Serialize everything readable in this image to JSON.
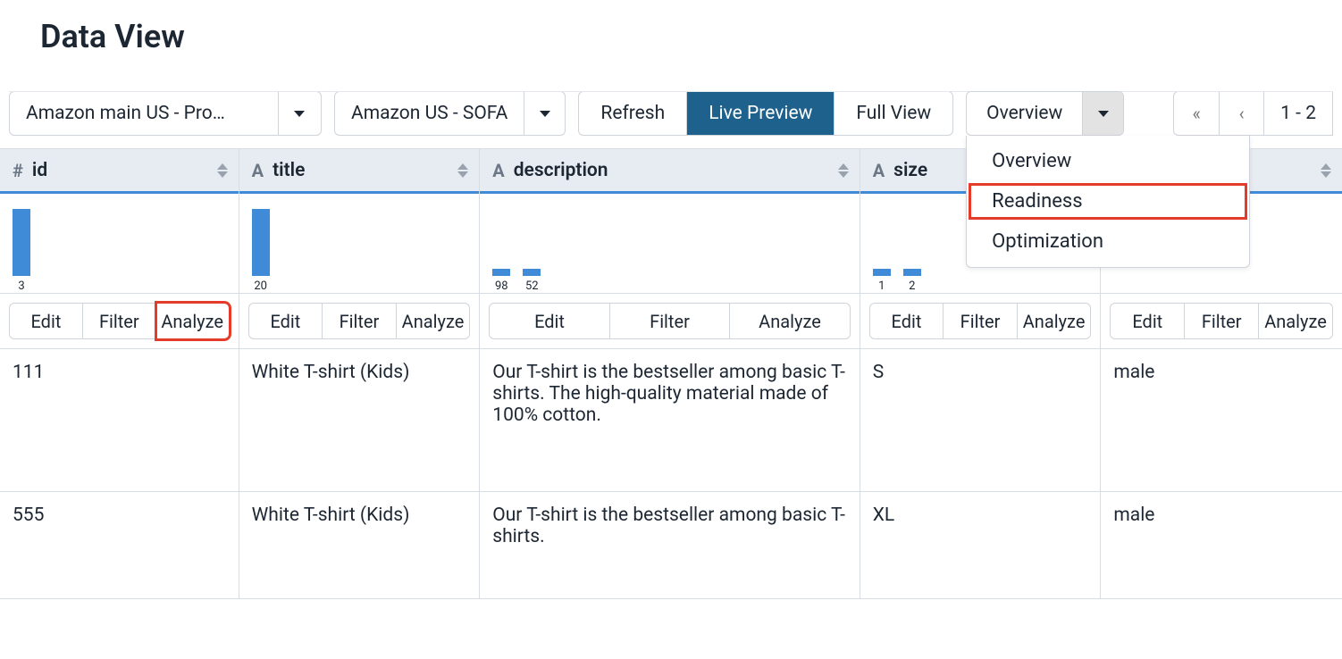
{
  "page_title": "Data View",
  "toolbar": {
    "source_select": "Amazon main US - Pro…",
    "channel_select": "Amazon US - SOFA",
    "refresh": "Refresh",
    "live_preview": "Live Preview",
    "full_view": "Full View",
    "overview_button": "Overview",
    "overview_menu": [
      "Overview",
      "Readiness",
      "Optimization"
    ],
    "pager": {
      "first": "«",
      "prev": "‹",
      "range": "1 - 2"
    }
  },
  "columns": [
    {
      "key": "id",
      "type": "#",
      "name": "id",
      "histo": [
        {
          "label": "3",
          "h": 75
        }
      ]
    },
    {
      "key": "title",
      "type": "A",
      "name": "title",
      "histo": [
        {
          "label": "20",
          "h": 75
        }
      ]
    },
    {
      "key": "description",
      "type": "A",
      "name": "description",
      "histo": [
        {
          "label": "98",
          "h": 8
        },
        {
          "label": "52",
          "h": 8
        }
      ]
    },
    {
      "key": "size",
      "type": "A",
      "name": "size",
      "histo": [
        {
          "label": "1",
          "h": 8
        },
        {
          "label": "2",
          "h": 8
        }
      ]
    },
    {
      "key": "gender",
      "type": "A",
      "name": "",
      "histo": []
    }
  ],
  "action_labels": {
    "edit": "Edit",
    "filter": "Filter",
    "analyze": "Analyze"
  },
  "rows": [
    {
      "id": "111",
      "title": "White T-shirt (Kids)",
      "description": "Our T-shirt is the bestseller among basic T-shirts. The high-quality material made of 100% cotton.",
      "size": "S",
      "gender": "male"
    },
    {
      "id": "555",
      "title": "White T-shirt (Kids)",
      "description": "Our T-shirt is the bestseller among basic T-shirts.",
      "size": "XL",
      "gender": "male"
    }
  ]
}
